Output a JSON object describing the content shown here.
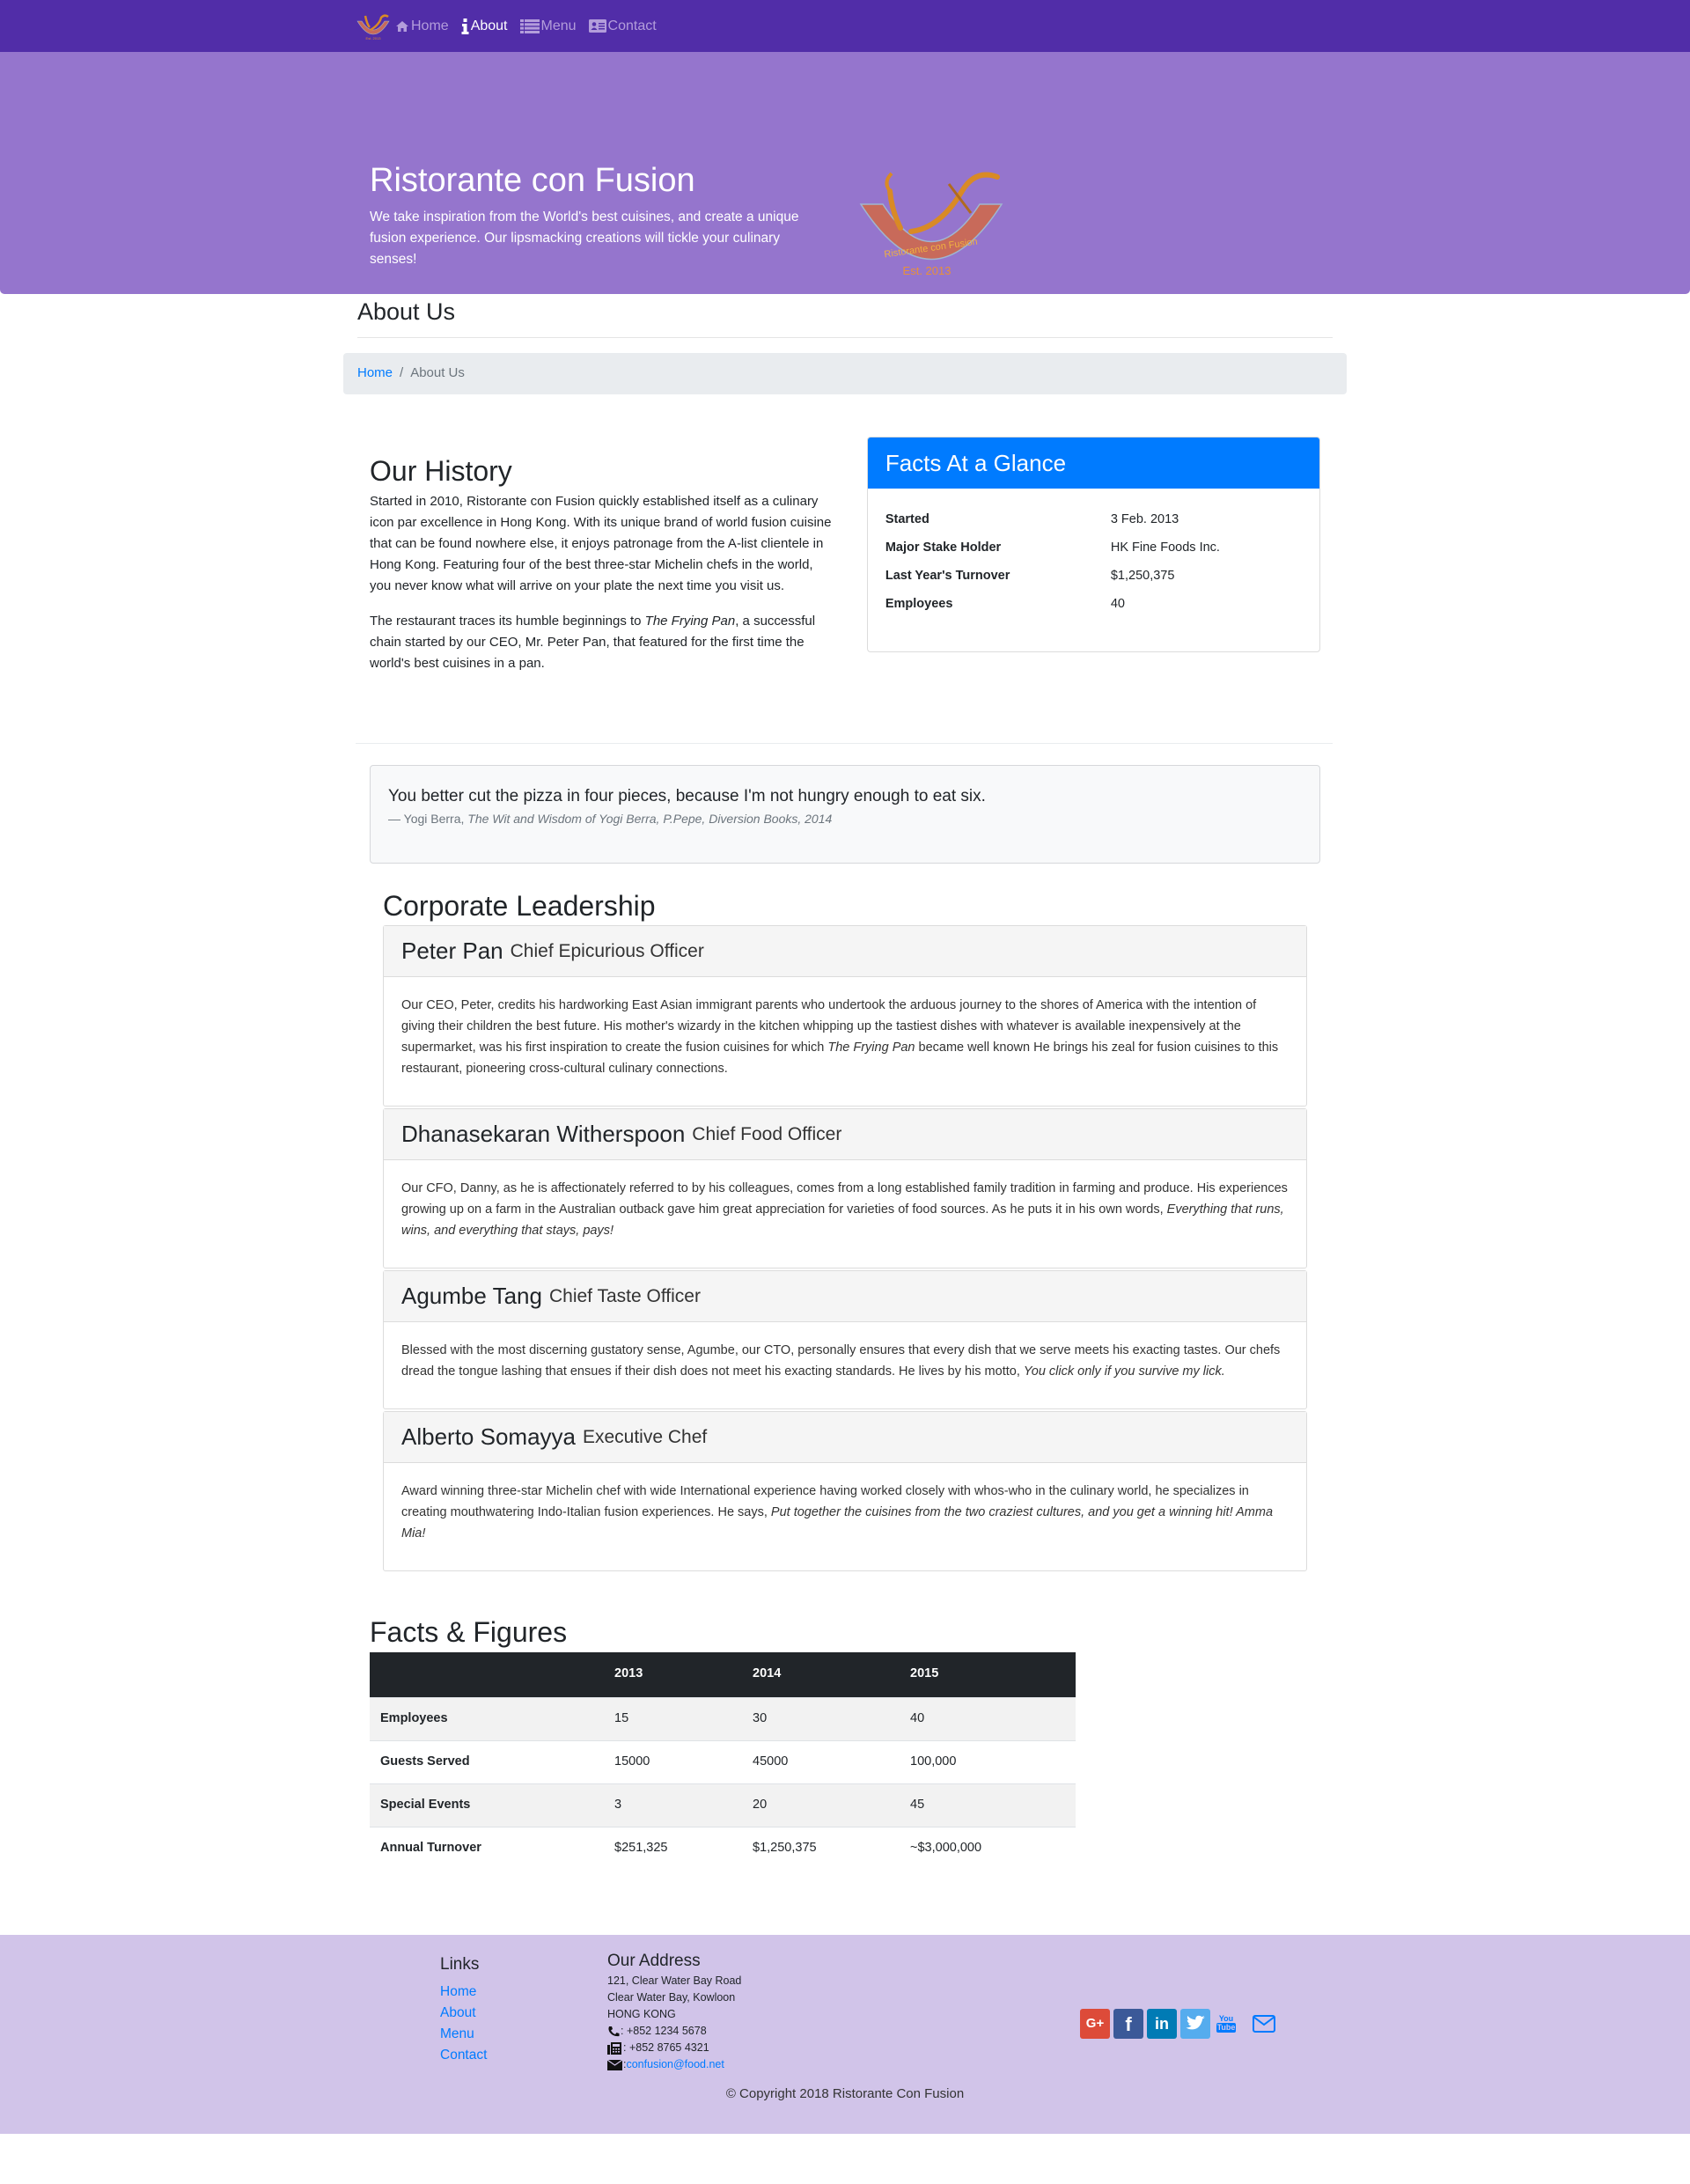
{
  "colors": {
    "navbar": "#512DA8",
    "jumbotron": "#9575CD",
    "footer": "#D1C4E9",
    "primary": "#007bff",
    "table_header": "#212529"
  },
  "navbar": {
    "logo": "restaurant-logo",
    "items": [
      {
        "label": "Home",
        "icon": "home-icon",
        "active": false
      },
      {
        "label": "About",
        "icon": "info-icon",
        "active": true
      },
      {
        "label": "Menu",
        "icon": "list-icon",
        "active": false
      },
      {
        "label": "Contact",
        "icon": "address-card-icon",
        "active": false
      }
    ]
  },
  "jumbotron": {
    "title": "Ristorante con Fusion",
    "text": "We take inspiration from the World's best cuisines, and create a unique fusion experience. Our lipsmacking creations will tickle your culinary senses!",
    "logo_text": "Ristorante con Fusion",
    "logo_est": "Est. 2013"
  },
  "page_header": {
    "title": "About Us"
  },
  "breadcrumb": {
    "home": "Home",
    "separator": "/",
    "current": "About Us"
  },
  "history": {
    "title": "Our History",
    "paragraph1": "Started in 2010, Ristorante con Fusion quickly established itself as a culinary icon par excellence in Hong Kong. With its unique brand of world fusion cuisine that can be found nowhere else, it enjoys patronage from the A-list clientele in Hong Kong. Featuring four of the best three-star Michelin chefs in the world, you never know what will arrive on your plate the next time you visit us.",
    "paragraph2_before": "The restaurant traces its humble beginnings to ",
    "paragraph2_em": "The Frying Pan",
    "paragraph2_after": ", a successful chain started by our CEO, Mr. Peter Pan, that featured for the first time the world's best cuisines in a pan."
  },
  "facts_card": {
    "title": "Facts At a Glance",
    "rows": [
      {
        "label": "Started",
        "value": "3 Feb. 2013"
      },
      {
        "label": "Major Stake Holder",
        "value": "HK Fine Foods Inc."
      },
      {
        "label": "Last Year's Turnover",
        "value": "$1,250,375"
      },
      {
        "label": "Employees",
        "value": "40"
      }
    ]
  },
  "quote": {
    "text": "You better cut the pizza in four pieces, because I'm not hungry enough to eat six.",
    "author": "— Yogi Berra, ",
    "source": "The Wit and Wisdom of Yogi Berra, P.Pepe, Diversion Books, 2014"
  },
  "leadership": {
    "title": "Corporate Leadership",
    "leaders": [
      {
        "name": "Peter Pan",
        "designation": "Chief Epicurious Officer",
        "text_before": "Our CEO, Peter, credits his hardworking East Asian immigrant parents who undertook the arduous journey to the shores of America with the intention of giving their children the best future. His mother's wizardy in the kitchen whipping up the tastiest dishes with whatever is available inexpensively at the supermarket, was his first inspiration to create the fusion cuisines for which ",
        "text_em": "The Frying Pan",
        "text_after": " became well known He brings his zeal for fusion cuisines to this restaurant, pioneering cross-cultural culinary connections."
      },
      {
        "name": "Dhanasekaran Witherspoon",
        "designation": "Chief Food Officer",
        "text_before": "Our CFO, Danny, as he is affectionately referred to by his colleagues, comes from a long established family tradition in farming and produce. His experiences growing up on a farm in the Australian outback gave him great appreciation for varieties of food sources. As he puts it in his own words, ",
        "text_em": "Everything that runs, wins, and everything that stays, pays!",
        "text_after": ""
      },
      {
        "name": "Agumbe Tang",
        "designation": "Chief Taste Officer",
        "text_before": "Blessed with the most discerning gustatory sense, Agumbe, our CTO, personally ensures that every dish that we serve meets his exacting tastes. Our chefs dread the tongue lashing that ensues if their dish does not meet his exacting standards. He lives by his motto, ",
        "text_em": "You click only if you survive my lick.",
        "text_after": ""
      },
      {
        "name": "Alberto Somayya",
        "designation": "Executive Chef",
        "text_before": "Award winning three-star Michelin chef with wide International experience having worked closely with whos-who in the culinary world, he specializes in creating mouthwatering Indo-Italian fusion experiences. He says, ",
        "text_em": "Put together the cuisines from the two craziest cultures, and you get a winning hit! Amma Mia!",
        "text_after": ""
      }
    ]
  },
  "figures": {
    "title": "Facts & Figures",
    "columns": [
      "",
      "2013",
      "2014",
      "2015"
    ],
    "rows": [
      [
        "Employees",
        "15",
        "30",
        "40"
      ],
      [
        "Guests Served",
        "15000",
        "45000",
        "100,000"
      ],
      [
        "Special Events",
        "3",
        "20",
        "45"
      ],
      [
        "Annual Turnover",
        "$251,325",
        "$1,250,375",
        "~$3,000,000"
      ]
    ]
  },
  "footer": {
    "links_title": "Links",
    "links": [
      "Home",
      "About",
      "Menu",
      "Contact"
    ],
    "address_title": "Our Address",
    "address_lines": [
      "121, Clear Water Bay Road",
      "Clear Water Bay, Kowloon",
      "HONG KONG"
    ],
    "phone": ": +852 1234 5678",
    "fax": ": +852 8765 4321",
    "email_sep": ": ",
    "email": "confusion@food.net",
    "social": [
      {
        "name": "google-plus-icon",
        "label": "G+",
        "color": "#dd4b39"
      },
      {
        "name": "facebook-icon",
        "label": "f",
        "color": "#3b5998"
      },
      {
        "name": "linkedin-icon",
        "label": "in",
        "color": "#007bb5"
      },
      {
        "name": "twitter-icon",
        "label": "",
        "color": "#55acee"
      },
      {
        "name": "youtube-icon",
        "label": "",
        "color": "#007bff"
      },
      {
        "name": "mail-icon",
        "label": "",
        "color": "#007bff"
      }
    ],
    "copyright": "© Copyright 2018 Ristorante Con Fusion"
  }
}
